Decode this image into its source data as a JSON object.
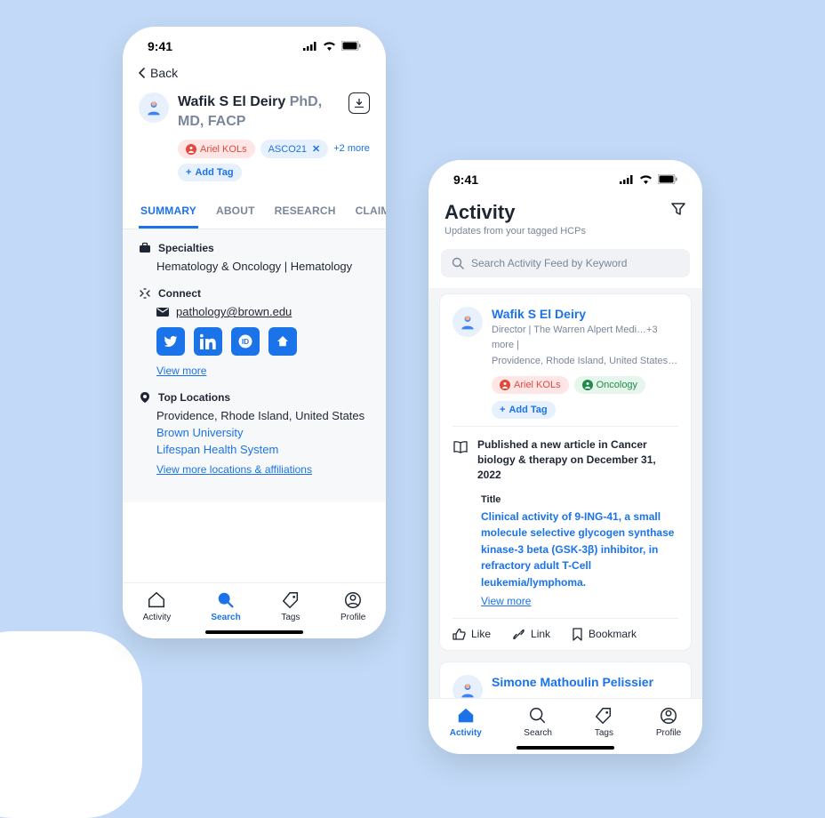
{
  "statusBar": {
    "time": "9:41"
  },
  "profile": {
    "back": "Back",
    "name": "Wafik S El Deiry",
    "degrees": "PhD, MD, FACP",
    "tags": {
      "ariel": "Ariel KOLs",
      "asco": "ASCO21",
      "more": "+2 more"
    },
    "addTag": "Add Tag",
    "tabs": {
      "summary": "SUMMARY",
      "about": "ABOUT",
      "research": "RESEARCH",
      "claims": "CLAIM"
    },
    "specialties": {
      "label": "Specialties",
      "value": "Hematology & Oncology | Hematology"
    },
    "connect": {
      "label": "Connect",
      "email": "pathology@brown.edu",
      "viewMore": "View more"
    },
    "locations": {
      "label": "Top Locations",
      "primary": "Providence, Rhode Island, United States",
      "links": {
        "brown": "Brown University",
        "lifespan": "Lifespan Health System"
      },
      "viewMore": "View more locations & affiliations"
    }
  },
  "tabbar": {
    "activity": "Activity",
    "search": "Search",
    "tags": "Tags",
    "profile": "Profile"
  },
  "activity": {
    "title": "Activity",
    "subtitle": "Updates from your tagged HCPs",
    "searchPlaceholder": "Search Activity Feed by Keyword",
    "card": {
      "name": "Wafik S El Deiry",
      "meta1": "Director | The Warren Alpert Medi…+3 more |",
      "meta2": "Providence, Rhode Island, United States…",
      "tags": {
        "ariel": "Ariel KOLs",
        "oncology": "Oncology"
      },
      "addTag": "Add Tag",
      "publication": "Published a new article in Cancer biology & therapy on December 31, 2022",
      "articleLabel": "Title",
      "articleTitle": "Clinical activity of 9-ING-41, a small molecule selective glycogen synthase kinase-3 beta (GSK-3β) inhibitor, in refractory adult T-Cell leukemia/lymphoma.",
      "viewMore": "View more",
      "actions": {
        "like": "Like",
        "link": "Link",
        "bookmark": "Bookmark"
      }
    },
    "card2": {
      "name": "Simone Mathoulin Pelissier"
    }
  }
}
